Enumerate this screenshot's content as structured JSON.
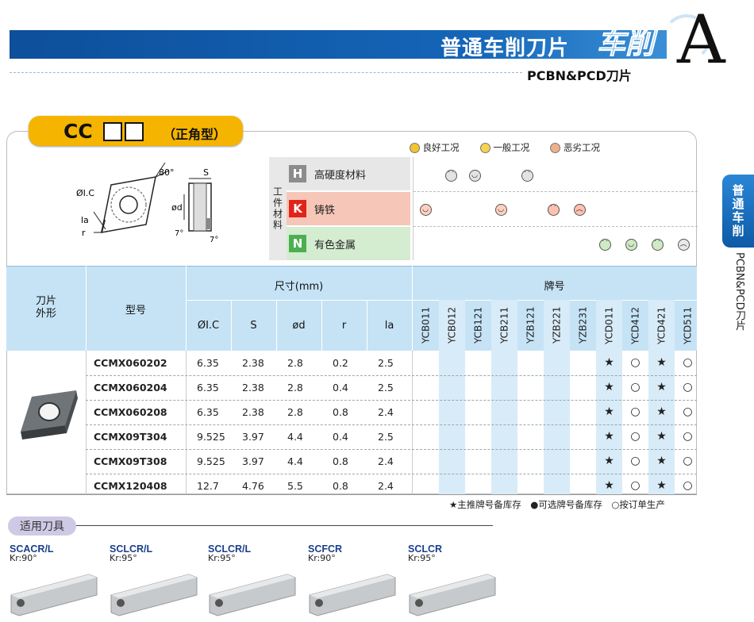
{
  "header": {
    "title": "普通车削刀片",
    "category": "车削",
    "letter": "A",
    "subtitle": "PCBN&PCD刀片"
  },
  "side_tab": {
    "label": "普通车削",
    "text": "PCBN&PCD刀片"
  },
  "insert": {
    "prefix": "CC",
    "shape_name": "（正角型）",
    "diagram_labels": {
      "angle": "80°",
      "ic": "ØI.C",
      "la": "la",
      "r": "r",
      "s": "S",
      "d": "ød",
      "clearance1": "7°",
      "clearance2": "7°"
    }
  },
  "legend": {
    "good": "良好工况",
    "ok": "一般工况",
    "bad": "恶劣工况"
  },
  "materials": {
    "group_label": "工件材料",
    "rows": [
      {
        "code": "H",
        "label": "高硬度材料",
        "color": "#8c8c8c"
      },
      {
        "code": "K",
        "label": "铸铁",
        "color": "#e2231a"
      },
      {
        "code": "N",
        "label": "有色金属",
        "color": "#4caf50"
      }
    ]
  },
  "table": {
    "col_shape": "刀片\n外形",
    "col_model": "型号",
    "col_dims": "尺寸(mm)",
    "col_brand": "牌号",
    "dim_headers": [
      "ØI.C",
      "S",
      "ød",
      "r",
      "la"
    ],
    "brands": [
      "YCB011",
      "YCB012",
      "YCB121",
      "YCB211",
      "YZB121",
      "YZB221",
      "YZB231",
      "YCD011",
      "YCD412",
      "YCD421",
      "YCD511"
    ],
    "rows": [
      {
        "model": "CCMX060202",
        "ic": "6.35",
        "s": "2.38",
        "d": "2.8",
        "r": "0.2",
        "la": "2.5",
        "marks": [
          "",
          "",
          "",
          "",
          "",
          "",
          "",
          "★",
          "○",
          "★",
          "○"
        ]
      },
      {
        "model": "CCMX060204",
        "ic": "6.35",
        "s": "2.38",
        "d": "2.8",
        "r": "0.4",
        "la": "2.5",
        "marks": [
          "",
          "",
          "",
          "",
          "",
          "",
          "",
          "★",
          "○",
          "★",
          "○"
        ]
      },
      {
        "model": "CCMX060208",
        "ic": "6.35",
        "s": "2.38",
        "d": "2.8",
        "r": "0.8",
        "la": "2.4",
        "marks": [
          "",
          "",
          "",
          "",
          "",
          "",
          "",
          "★",
          "○",
          "★",
          "○"
        ]
      },
      {
        "model": "CCMX09T304",
        "ic": "9.525",
        "s": "3.97",
        "d": "4.4",
        "r": "0.4",
        "la": "2.5",
        "marks": [
          "",
          "",
          "",
          "",
          "",
          "",
          "",
          "★",
          "○",
          "★",
          "○"
        ]
      },
      {
        "model": "CCMX09T308",
        "ic": "9.525",
        "s": "3.97",
        "d": "4.4",
        "r": "0.8",
        "la": "2.4",
        "marks": [
          "",
          "",
          "",
          "",
          "",
          "",
          "",
          "★",
          "○",
          "★",
          "○"
        ]
      },
      {
        "model": "CCMX120408",
        "ic": "12.7",
        "s": "4.76",
        "d": "5.5",
        "r": "0.8",
        "la": "2.4",
        "marks": [
          "",
          "",
          "",
          "",
          "",
          "",
          "",
          "★",
          "○",
          "★",
          "○"
        ]
      }
    ]
  },
  "footnote": "★主推牌号备库存　●可选牌号备库存　○按订单生产",
  "tools": {
    "label": "适用刀具",
    "items": [
      {
        "name": "SCACR/L",
        "kr": "Kr:90°"
      },
      {
        "name": "SCLCR/L",
        "kr": "Kr:95°"
      },
      {
        "name": "SCLCR/L",
        "kr": "Kr:95°"
      },
      {
        "name": "SCFCR",
        "kr": "Kr:90°"
      },
      {
        "name": "SCLCR",
        "kr": "Kr:95°"
      }
    ]
  }
}
